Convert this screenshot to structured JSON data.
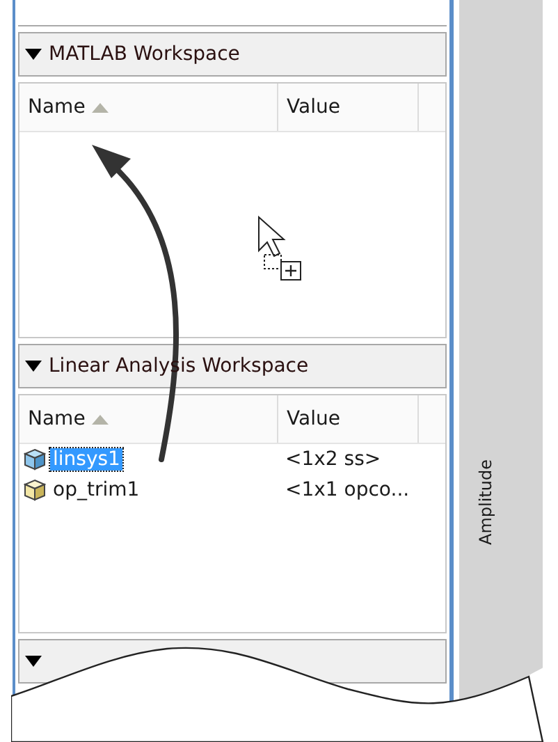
{
  "sections": [
    {
      "title": "MATLAB Workspace",
      "expanded": true,
      "columns": [
        {
          "label": "Name",
          "sorted": true
        },
        {
          "label": "Value",
          "sorted": false
        }
      ]
    },
    {
      "title": "Linear Analysis Workspace",
      "expanded": true,
      "columns": [
        {
          "label": "Name",
          "sorted": true
        },
        {
          "label": "Value",
          "sorted": false
        }
      ],
      "rows": [
        {
          "kind": "ss",
          "name": "linsys1",
          "value": "<1x2 ss>",
          "selected": true
        },
        {
          "kind": "opcond",
          "name": "op_trim1",
          "value": "<1x1 opco...",
          "selected": false
        }
      ]
    },
    {
      "expanded": true
    }
  ],
  "plot": {
    "ylabel": "Amplitude"
  }
}
